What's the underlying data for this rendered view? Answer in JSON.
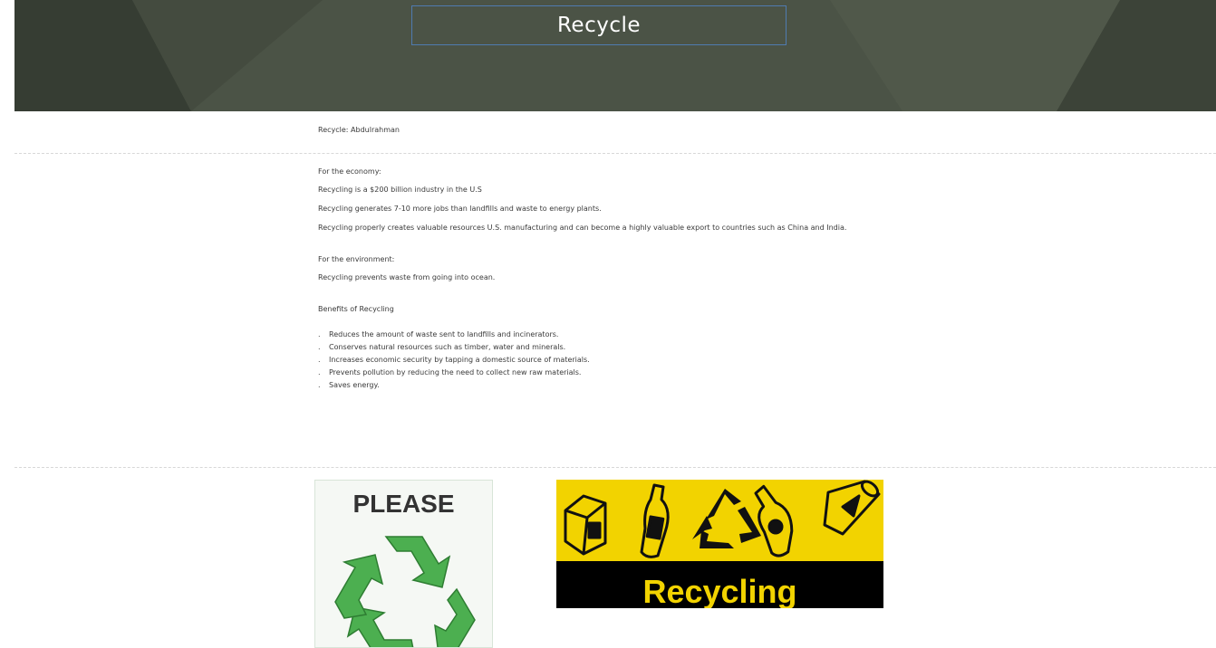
{
  "header": {
    "title": "Recycle"
  },
  "author": "Recycle: Abdulrahman",
  "economy": {
    "heading": "For the economy:",
    "lines": [
      "Recycling is a $200 billion industry in the U.S",
      "Recycling generates 7-10 more jobs than landfills and waste to energy plants.",
      "Recycling properly creates valuable resources U.S. manufacturing and can become a highly valuable export to countries such as China and India."
    ]
  },
  "environment": {
    "heading": "For the environment:",
    "lines": [
      "Recycling  prevents waste from going into ocean."
    ]
  },
  "benefits": {
    "heading": "Benefits of Recycling",
    "items": [
      "Reduces the amount of waste sent to landfills and incinerators.",
      "Conserves natural resources such as timber, water and minerals.",
      "Increases economic security by tapping a domestic source of materials.",
      "Prevents pollution by reducing the need to collect new raw materials.",
      "Saves energy."
    ]
  },
  "images": {
    "please_sign": {
      "text": "PLEASE",
      "icon": "recycle-icon",
      "color": "#4caf50"
    },
    "recycling_banner": {
      "text": "Recycling",
      "bg_color": "#f2d300",
      "icons": [
        "milk-carton-icon",
        "bottle-icon",
        "recycle-icon",
        "glass-bottle-icon",
        "can-icon"
      ]
    }
  },
  "colors": {
    "header_bg": "#4a5244",
    "title_border": "#4f7bb0",
    "banner_yellow": "#f2d300"
  }
}
